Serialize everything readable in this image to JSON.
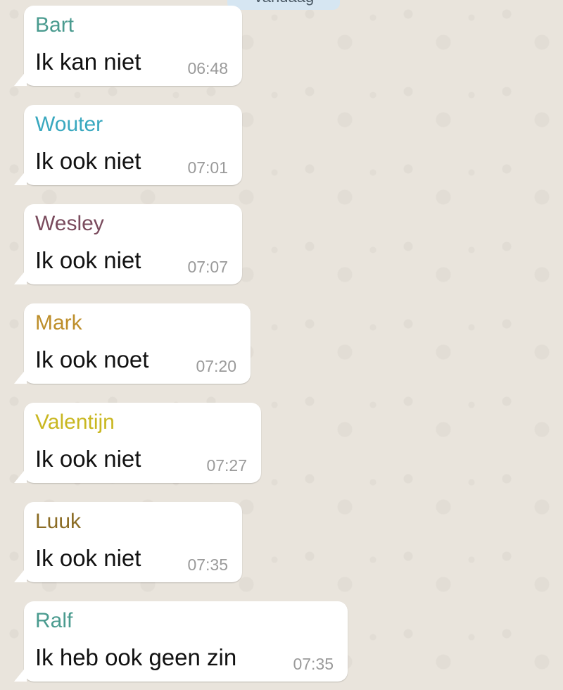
{
  "chat": {
    "date_label": "Vandaag",
    "messages": [
      {
        "sender": "Bart",
        "text": "Ik kan niet",
        "time": "06:48",
        "color": "#4a9b8f"
      },
      {
        "sender": "Wouter",
        "text": "Ik ook niet",
        "time": "07:01",
        "color": "#39a8bf"
      },
      {
        "sender": "Wesley",
        "text": "Ik ook niet",
        "time": "07:07",
        "color": "#7a4b5d"
      },
      {
        "sender": "Mark",
        "text": "Ik ook noet",
        "time": "07:20",
        "color": "#bd8e2a"
      },
      {
        "sender": "Valentijn",
        "text": "Ik ook niet",
        "time": "07:27",
        "color": "#c9b721"
      },
      {
        "sender": "Luuk",
        "text": "Ik ook niet",
        "time": "07:35",
        "color": "#8b6c24"
      },
      {
        "sender": "Ralf",
        "text": "Ik heb ook geen zin",
        "time": "07:35",
        "color": "#4a9b8f"
      }
    ]
  }
}
